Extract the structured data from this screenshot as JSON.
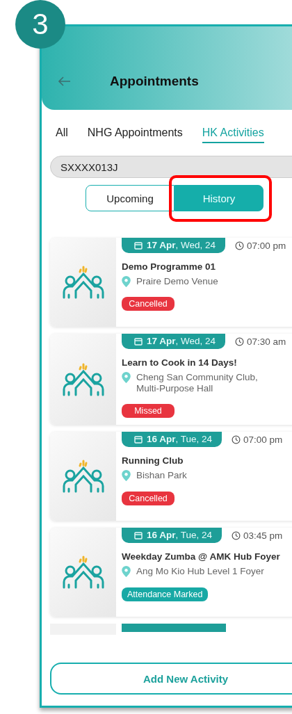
{
  "step_badge": "3",
  "header": {
    "title": "Appointments"
  },
  "tabs": [
    {
      "label": "All",
      "selected": false
    },
    {
      "label": "NHG Appointments",
      "selected": false
    },
    {
      "label": "HK Activities",
      "selected": true
    }
  ],
  "id_field": {
    "value": "SXXXX013J"
  },
  "segments": [
    {
      "label": "Upcoming",
      "selected": false,
      "highlighted": false
    },
    {
      "label": "History",
      "selected": true,
      "highlighted": true
    }
  ],
  "activities": [
    {
      "date": "**17 Apr**, Wed, 24",
      "time": "07:00 pm",
      "title": "Demo Programme 01",
      "venue": "Praire Demo Venue",
      "status": "Cancelled",
      "kind": "negative"
    },
    {
      "date": "**17 Apr**, Wed, 24",
      "time": "07:30 am",
      "title": "Learn to Cook in 14 Days!",
      "venue": "Cheng San Community Club, Multi-Purpose Hall",
      "status": "Missed",
      "kind": "negative"
    },
    {
      "date": "**16 Apr**, Tue, 24",
      "time": "07:00 pm",
      "title": "Running Club",
      "venue": "Bishan Park",
      "status": "Cancelled",
      "kind": "negative"
    },
    {
      "date": "**16 Apr**, Tue, 24",
      "time": "03:45 pm",
      "title": "Weekday Zumba @ AMK Hub Foyer",
      "venue": "Ang Mo Kio Hub Level 1 Foyer",
      "status": "Attendance Marked",
      "kind": "positive"
    }
  ],
  "add_button": "Add New Activity"
}
